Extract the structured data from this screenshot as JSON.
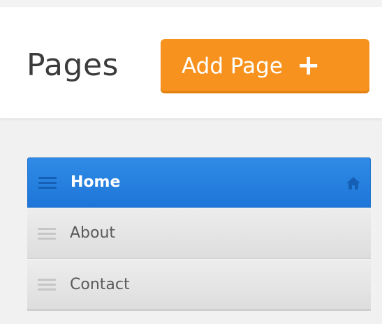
{
  "header": {
    "title": "Pages",
    "add_button_label": "Add Page",
    "add_button_icon": "plus-icon"
  },
  "pages": [
    {
      "label": "Home",
      "active": true,
      "icon": "home-icon"
    },
    {
      "label": "About",
      "active": false
    },
    {
      "label": "Contact",
      "active": false
    }
  ],
  "colors": {
    "accent_orange": "#f7921e",
    "active_blue": "#1e76d8",
    "item_gray": "#e4e4e4"
  }
}
